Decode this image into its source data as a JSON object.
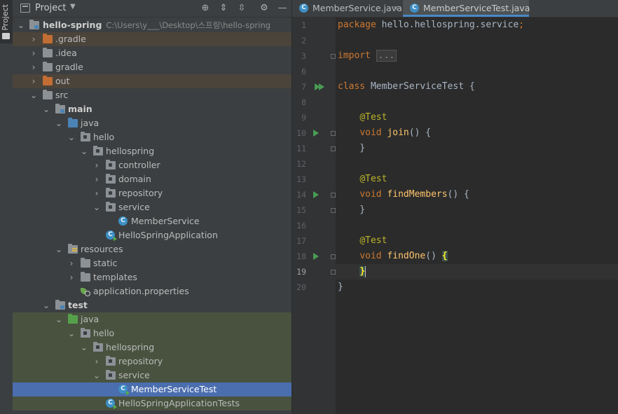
{
  "tool_strip": {
    "project_tab_label": "Project"
  },
  "project_panel": {
    "title": "Project",
    "tree": [
      {
        "label": "hello-spring",
        "path": "C:\\Users\\y___\\Desktop\\스프링\\hello-spring"
      },
      {
        "label": ".gradle"
      },
      {
        "label": ".idea"
      },
      {
        "label": "gradle"
      },
      {
        "label": "out"
      },
      {
        "label": "src"
      },
      {
        "label": "main"
      },
      {
        "label": "java"
      },
      {
        "label": "hello"
      },
      {
        "label": "hellospring"
      },
      {
        "label": "controller"
      },
      {
        "label": "domain"
      },
      {
        "label": "repository"
      },
      {
        "label": "service"
      },
      {
        "label": "MemberService"
      },
      {
        "label": "HelloSpringApplication"
      },
      {
        "label": "resources"
      },
      {
        "label": "static"
      },
      {
        "label": "templates"
      },
      {
        "label": "application.properties"
      },
      {
        "label": "test"
      },
      {
        "label": "java"
      },
      {
        "label": "hello"
      },
      {
        "label": "hellospring"
      },
      {
        "label": "repository"
      },
      {
        "label": "service"
      },
      {
        "label": "MemberServiceTest"
      },
      {
        "label": "HelloSpringApplicationTests"
      }
    ]
  },
  "editor": {
    "tabs": [
      {
        "label": "MemberService.java",
        "active": false
      },
      {
        "label": "MemberServiceTest.java",
        "active": true
      }
    ],
    "current_line": 19,
    "lines": [
      {
        "n": "1",
        "tokens": [
          {
            "t": "package ",
            "c": "kw"
          },
          {
            "t": "hello.hellospring.service",
            "c": ""
          },
          {
            "t": ";",
            "c": "kw"
          }
        ]
      },
      {
        "n": "2",
        "tokens": []
      },
      {
        "n": "3",
        "tokens": [
          {
            "t": "import ",
            "c": "kw"
          },
          {
            "t": "...",
            "c": "fold"
          }
        ]
      },
      {
        "n": "6",
        "tokens": []
      },
      {
        "n": "7",
        "tokens": [
          {
            "t": "class ",
            "c": "kw"
          },
          {
            "t": "MemberServiceTest {",
            "c": ""
          }
        ]
      },
      {
        "n": "8",
        "tokens": []
      },
      {
        "n": "9",
        "tokens": [
          {
            "t": "    ",
            "c": ""
          },
          {
            "t": "@Test",
            "c": "ann"
          }
        ]
      },
      {
        "n": "10",
        "tokens": [
          {
            "t": "    ",
            "c": ""
          },
          {
            "t": "void ",
            "c": "kw"
          },
          {
            "t": "join",
            "c": "fn"
          },
          {
            "t": "() {",
            "c": ""
          }
        ]
      },
      {
        "n": "11",
        "tokens": [
          {
            "t": "    }",
            "c": ""
          }
        ]
      },
      {
        "n": "12",
        "tokens": []
      },
      {
        "n": "13",
        "tokens": [
          {
            "t": "    ",
            "c": ""
          },
          {
            "t": "@Test",
            "c": "ann"
          }
        ]
      },
      {
        "n": "14",
        "tokens": [
          {
            "t": "    ",
            "c": ""
          },
          {
            "t": "void ",
            "c": "kw"
          },
          {
            "t": "findMembers",
            "c": "fn"
          },
          {
            "t": "() {",
            "c": ""
          }
        ]
      },
      {
        "n": "15",
        "tokens": [
          {
            "t": "    }",
            "c": ""
          }
        ]
      },
      {
        "n": "16",
        "tokens": []
      },
      {
        "n": "17",
        "tokens": [
          {
            "t": "    ",
            "c": ""
          },
          {
            "t": "@Test",
            "c": "ann"
          }
        ]
      },
      {
        "n": "18",
        "tokens": [
          {
            "t": "    ",
            "c": ""
          },
          {
            "t": "void ",
            "c": "kw"
          },
          {
            "t": "findOne",
            "c": "fn"
          },
          {
            "t": "() ",
            "c": ""
          },
          {
            "t": "{",
            "c": "brmatch"
          }
        ]
      },
      {
        "n": "19",
        "tokens": [
          {
            "t": "    ",
            "c": ""
          },
          {
            "t": "}",
            "c": "brmatch"
          }
        ]
      },
      {
        "n": "20",
        "tokens": [
          {
            "t": "}",
            "c": ""
          }
        ]
      }
    ]
  }
}
